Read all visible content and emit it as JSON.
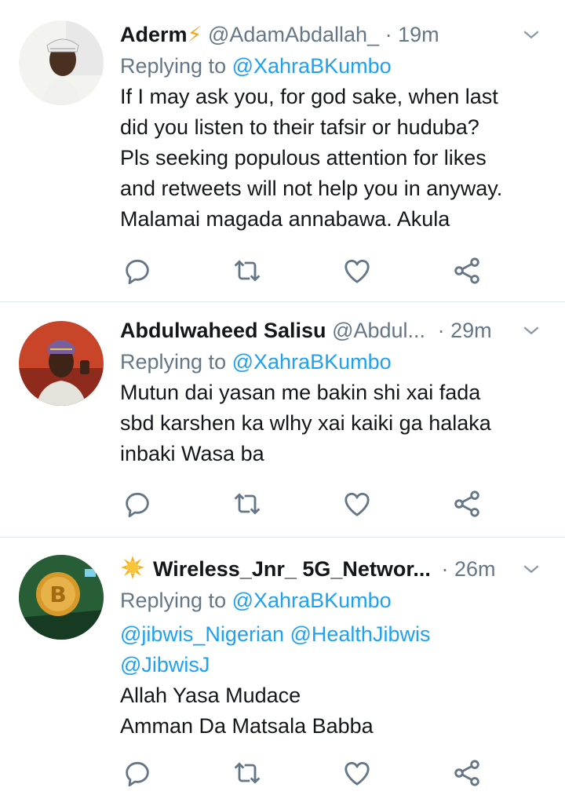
{
  "tweets": [
    {
      "name": "Aderm",
      "name_emoji": "⚡",
      "handle": "@AdamAbdallah_",
      "dot": "·",
      "time": "19m",
      "replying_prefix": "Replying to",
      "replying_to": "@XahraBKumbo",
      "lines": [
        "If I may ask you, for god sake, when last",
        "did you listen to their tafsir or huduba?",
        "Pls seeking populous attention for likes",
        "and retweets will not help you in anyway.",
        "Malamai magada annabawa. Akula"
      ]
    },
    {
      "name": "Abdulwaheed Salisu",
      "handle": "@Abdul...",
      "dot": "·",
      "time": "29m",
      "replying_prefix": "Replying to",
      "replying_to": "@XahraBKumbo",
      "lines": [
        "Mutun dai yasan me bakin shi xai fada",
        "sbd karshen ka wlhy xai kaiki ga halaka",
        "inbaki Wasa ba"
      ]
    },
    {
      "name": "Wireless_Jnr_ 5G_Networ...",
      "name_emoji": "sun",
      "dot": "·",
      "time": "26m",
      "replying_prefix": "Replying to",
      "replying_to": "@XahraBKumbo",
      "mention_line_1": "@jibwis_Nigerian @HealthJibwis",
      "mention_line_2": "@JibwisJ",
      "lines": [
        "Allah Yasa Mudace",
        "Amman Da Matsala Babba"
      ]
    }
  ],
  "icons": {
    "reply": "reply-icon",
    "retweet": "retweet-icon",
    "like": "like-icon",
    "share": "share-icon",
    "more": "chevron-down-icon"
  },
  "colors": {
    "accent": "#1da1f2",
    "secondary": "#657786",
    "text": "#14171a",
    "divider": "#e1e8ed"
  }
}
